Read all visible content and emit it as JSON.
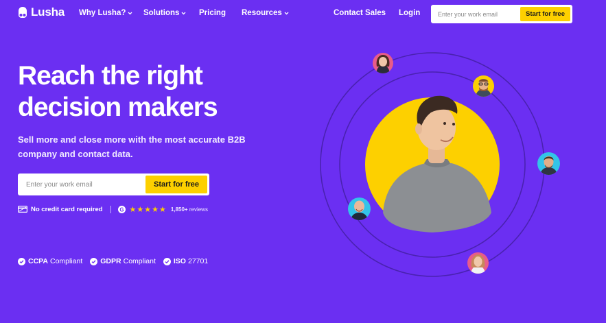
{
  "brand": {
    "name": "Lusha"
  },
  "nav": {
    "items": [
      {
        "label": "Why Lusha?",
        "dropdown": true
      },
      {
        "label": "Solutions",
        "dropdown": true
      },
      {
        "label": "Pricing",
        "dropdown": false
      },
      {
        "label": "Resources",
        "dropdown": true
      }
    ],
    "contact_sales": "Contact Sales",
    "login": "Login",
    "email_placeholder": "Enter your work email",
    "cta": "Start for free"
  },
  "hero": {
    "title_line1": "Reach the right",
    "title_line2": "decision makers",
    "subtitle_line1": "Sell more and close more with the most accurate B2B",
    "subtitle_line2": "company and contact data.",
    "email_placeholder": "Enter your work email",
    "cta": "Start for free",
    "no_credit_card": "No credit card required",
    "rating_stars": 5,
    "reviews_count": "1,850+",
    "reviews_label": "reviews"
  },
  "compliance": [
    {
      "strong": "CCPA",
      "text": "Compliant"
    },
    {
      "strong": "GDPR",
      "text": "Compliant"
    },
    {
      "strong": "ISO",
      "text": "27701"
    }
  ],
  "colors": {
    "background": "#6b2ff2",
    "accent_yellow": "#fdd000",
    "orbit_ring": "#4a22b0"
  },
  "icons": [
    "lusha-logo-icon",
    "chevron-down-icon",
    "credit-card-icon",
    "g2-icon",
    "star-icon",
    "check-circle-icon"
  ]
}
